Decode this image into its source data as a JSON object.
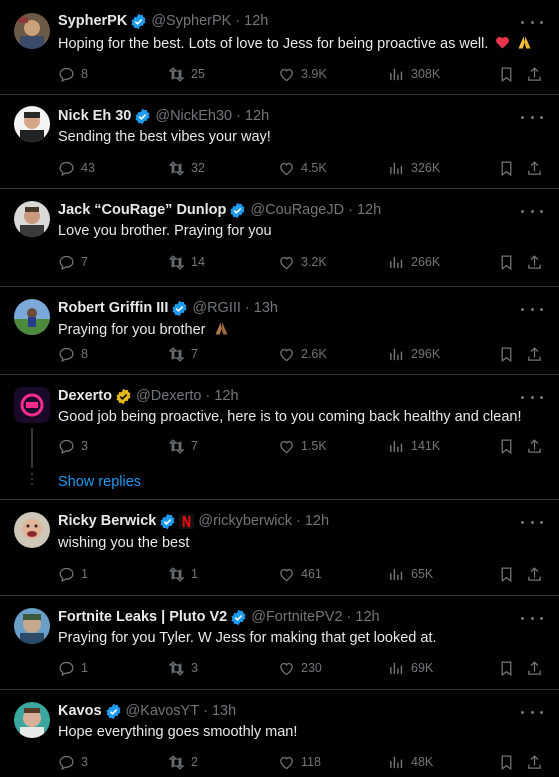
{
  "tweets": [
    {
      "name": "SypherPK",
      "handle": "@SypherPK",
      "time": "12h",
      "verified": "blue",
      "text": "Hoping for the best. Lots of love to Jess for being proactive as well.",
      "emoji": "heart-and-pray",
      "replies": "8",
      "retweets": "25",
      "likes": "3.9K",
      "views": "308K"
    },
    {
      "name": "Nick Eh 30",
      "handle": "@NickEh30",
      "time": "12h",
      "verified": "blue",
      "text": "Sending the best vibes your way!",
      "replies": "43",
      "retweets": "32",
      "likes": "4.5K",
      "views": "326K"
    },
    {
      "name": "Jack “CouRage” Dunlop",
      "handle": "@CouRageJD",
      "time": "12h",
      "verified": "blue",
      "text": "Love you brother. Praying for you",
      "replies": "7",
      "retweets": "14",
      "likes": "3.2K",
      "views": "266K"
    },
    {
      "name": "Robert Griffin III",
      "handle": "@RGIII",
      "time": "13h",
      "verified": "blue",
      "text": "Praying for you brother",
      "emoji": "pray",
      "replies": "8",
      "retweets": "7",
      "likes": "2.6K",
      "views": "296K"
    },
    {
      "name": "Dexerto",
      "handle": "@Dexerto",
      "time": "12h",
      "verified": "gold",
      "text": "Good job being proactive, here is to you coming back healthy and clean!",
      "replies": "3",
      "retweets": "7",
      "likes": "1.5K",
      "views": "141K",
      "show_replies": "Show replies"
    },
    {
      "name": "Ricky Berwick",
      "handle": "@rickyberwick",
      "time": "12h",
      "verified": "blue",
      "affiliate_badge": "netflix-badge",
      "text": "wishing you the best",
      "replies": "1",
      "retweets": "1",
      "likes": "461",
      "views": "65K"
    },
    {
      "name": "Fortnite Leaks | Pluto V2",
      "handle": "@FortnitePV2",
      "time": "12h",
      "verified": "blue",
      "text": "Praying for you Tyler. W Jess for making that get looked at.",
      "replies": "1",
      "retweets": "3",
      "likes": "230",
      "views": "69K"
    },
    {
      "name": "Kavos",
      "handle": "@KavosYT",
      "time": "13h",
      "verified": "blue",
      "text": "Hope everything goes smoothly man!",
      "replies": "3",
      "retweets": "2",
      "likes": "118",
      "views": "48K"
    }
  ],
  "separator": "·",
  "colors": {
    "background": "#000000",
    "text": "#e7e9ea",
    "muted": "#71767b",
    "link": "#1d9bf0",
    "verified_blue": "#1d9bf0",
    "verified_gold": "#e2b719",
    "border": "#2f3336"
  }
}
